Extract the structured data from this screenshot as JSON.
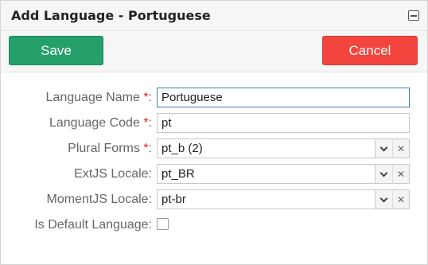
{
  "window": {
    "title": "Add Language - Portuguese"
  },
  "toolbar": {
    "save_label": "Save",
    "cancel_label": "Cancel",
    "save_color": "#26a06a",
    "cancel_color": "#f2453d"
  },
  "form": {
    "required_marker": "*",
    "fields": {
      "language_name": {
        "label": "Language Name",
        "required": true,
        "value": "Portuguese"
      },
      "language_code": {
        "label": "Language Code",
        "required": true,
        "value": "pt"
      },
      "plural_forms": {
        "label": "Plural Forms",
        "required": true,
        "value": "pt_b (2)"
      },
      "extjs_locale": {
        "label": "ExtJS Locale:",
        "required": false,
        "value": "pt_BR"
      },
      "momentjs_locale": {
        "label": "MomentJS Locale:",
        "required": false,
        "value": "pt-br"
      },
      "is_default": {
        "label": "Is Default Language:",
        "checked": false
      }
    },
    "colon": ":"
  },
  "icons": {
    "collapse": "collapse-icon",
    "dropdown": "chevron-down-icon",
    "clear": "clear-x-icon",
    "clear_glyph": "✕"
  }
}
